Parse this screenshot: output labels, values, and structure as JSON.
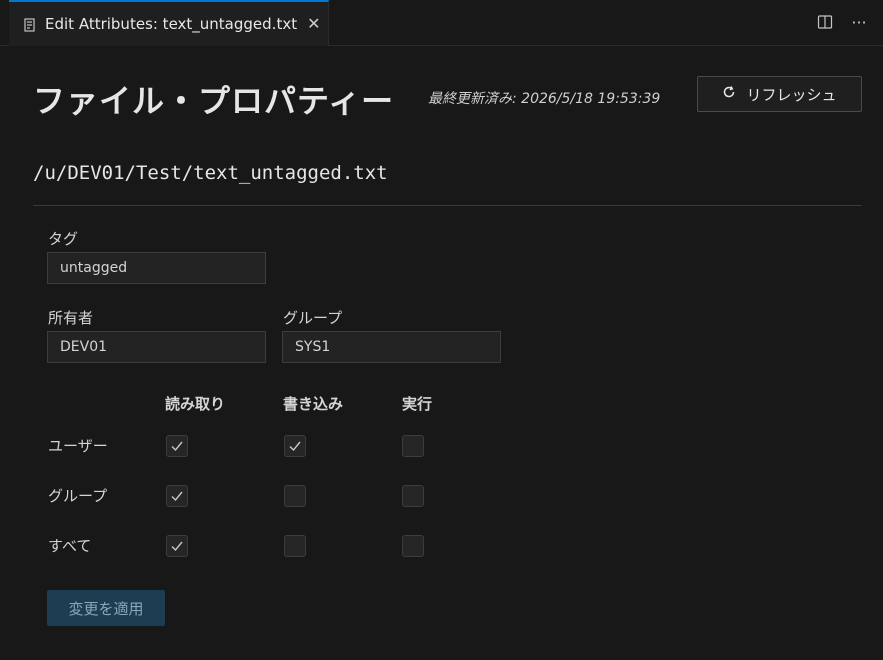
{
  "tab": {
    "label": "Edit Attributes: text_untagged.txt",
    "close_glyph": "✕",
    "icon": "file-text-icon",
    "more_glyph": "···"
  },
  "header": {
    "title": "ファイル・プロパティー",
    "last_updated": "最終更新済み: 2026/5/18 19:53:39",
    "refresh_label": "リフレッシュ"
  },
  "path": "/u/DEV01/Test/text_untagged.txt",
  "fields": {
    "tag_label": "タグ",
    "tag_value": "untagged",
    "owner_label": "所有者",
    "owner_value": "DEV01",
    "group_label": "グループ",
    "group_value": "SYS1"
  },
  "permissions": {
    "columns": [
      "読み取り",
      "書き込み",
      "実行"
    ],
    "rows": [
      {
        "label": "ユーザー",
        "values": [
          true,
          true,
          false
        ]
      },
      {
        "label": "グループ",
        "values": [
          true,
          false,
          false
        ]
      },
      {
        "label": "すべて",
        "values": [
          true,
          false,
          false
        ]
      }
    ]
  },
  "apply_label": "変更を適用",
  "colors": {
    "accent": "#0078d4",
    "background": "#181818",
    "apply_button": "#1d3d52"
  }
}
